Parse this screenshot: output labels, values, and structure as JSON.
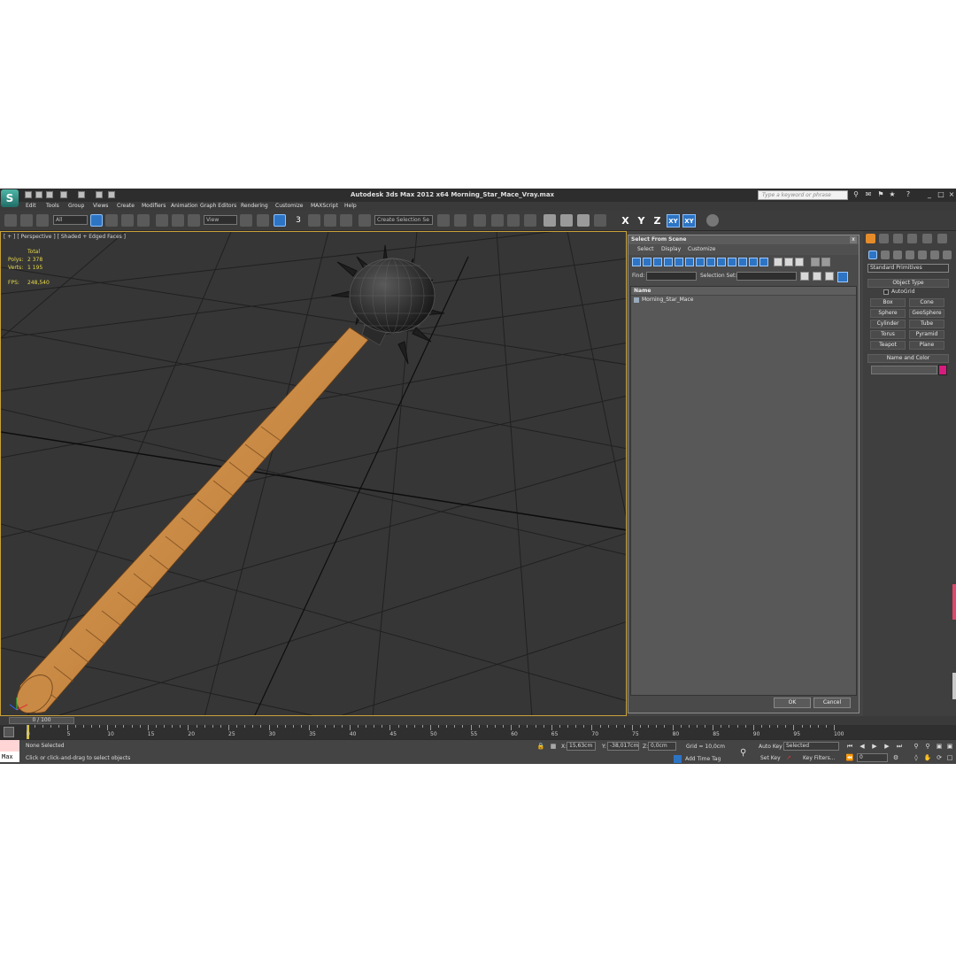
{
  "app": {
    "logo": "S",
    "title": "Autodesk 3ds Max  2012 x64     Morning_Star_Mace_Vray.max",
    "search_placeholder": "Type a keyword or phrase"
  },
  "menu": [
    "Edit",
    "Tools",
    "Group",
    "Views",
    "Create",
    "Modifiers",
    "Animation",
    "Graph Editors",
    "Rendering",
    "Customize",
    "MAXScript",
    "Help"
  ],
  "toolbar": {
    "filter_value": "All",
    "refcoord_value": "View",
    "selection_set_value": "Create Selection Se",
    "snap_label": "3",
    "axis": [
      "X",
      "Y",
      "Z",
      "XY",
      "XY"
    ]
  },
  "viewport": {
    "label": "[ + ] [ Perspective ] [ Shaded + Edged Faces ]",
    "stats": {
      "header": "Total",
      "rows": [
        {
          "label": "Polys:",
          "value": "2 378"
        },
        {
          "label": "Verts:",
          "value": "1 195"
        },
        {
          "label": "FPS:",
          "value": "248,540"
        }
      ]
    }
  },
  "dialog": {
    "title": "Select From Scene",
    "close": "x",
    "menu": [
      "Select",
      "Display",
      "Customize"
    ],
    "find_label": "Find:",
    "selection_set_label": "Selection Set:",
    "column_header": "Name",
    "objects": [
      "Morning_Star_Mace"
    ],
    "ok_label": "OK",
    "cancel_label": "Cancel"
  },
  "command_panel": {
    "category": "Standard Primitives",
    "object_type_header": "Object Type",
    "autogrid_label": "AutoGrid",
    "primitives": [
      "Box",
      "Cone",
      "Sphere",
      "GeoSphere",
      "Cylinder",
      "Tube",
      "Torus",
      "Pyramid",
      "Teapot",
      "Plane"
    ],
    "name_color_header": "Name and Color",
    "object_color": "#d81b7e"
  },
  "timeline": {
    "slider_label": "0 / 100",
    "ticks": [
      "0",
      "5",
      "10",
      "15",
      "20",
      "25",
      "30",
      "35",
      "40",
      "45",
      "50",
      "55",
      "60",
      "65",
      "70",
      "75",
      "80",
      "85",
      "90",
      "95",
      "100"
    ]
  },
  "status": {
    "maxscript": "Max",
    "selection": "None Selected",
    "prompt": "Click or click-and-drag to select objects",
    "x_label": "X:",
    "x_value": "15,63cm",
    "y_label": "Y:",
    "y_value": "-38,017cm",
    "z_label": "Z:",
    "z_value": "0,0cm",
    "grid": "Grid = 10,0cm",
    "add_time_tag": "Add Time Tag",
    "auto_key": "Auto Key",
    "set_key": "Set Key",
    "selected_value": "Selected",
    "key_filters": "Key Filters...",
    "frame_value": "0"
  }
}
